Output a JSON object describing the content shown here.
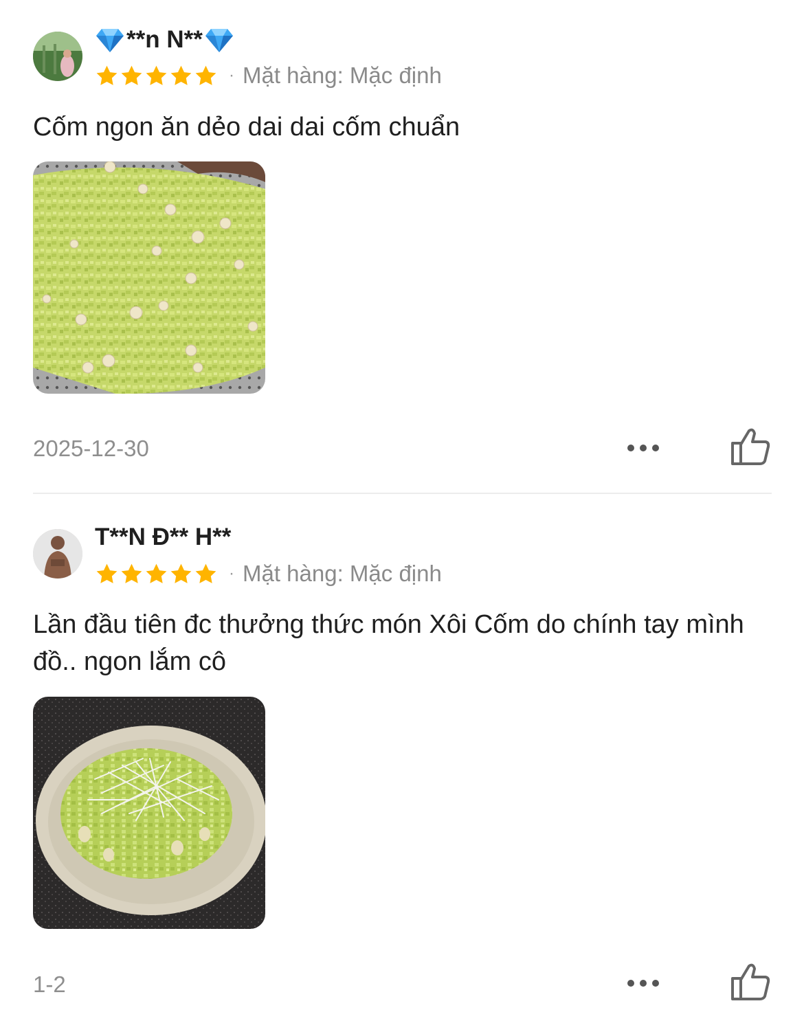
{
  "reviews": [
    {
      "username": "**n N**",
      "rating": 5,
      "separator": "·",
      "variant": "Mặt hàng: Mặc định",
      "comment": "Cốm ngon ăn dẻo dai dai cốm chuẩn",
      "date": "2025-12-30",
      "photo_icon": "green-rice-flakes-photo"
    },
    {
      "username": "T**N Đ** H**",
      "rating": 5,
      "separator": "·",
      "variant": "Mặt hàng: Mặc định",
      "comment": "Lần đầu tiên đc thưởng thức món Xôi Cốm do chính tay mình đồ.. ngon lắm cô",
      "date": "1-2",
      "photo_icon": "sticky-rice-bowl-photo"
    }
  ],
  "colors": {
    "star": "#FFB400",
    "diamond": "#3EA8F5",
    "muted_text": "#8A8A8A",
    "icon_gray": "#666666"
  }
}
